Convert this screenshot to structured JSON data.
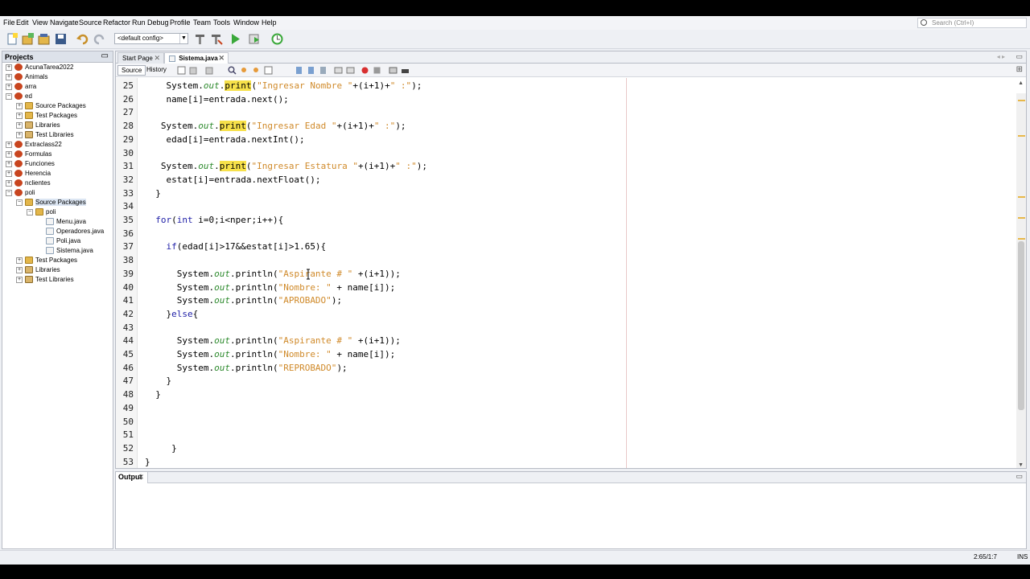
{
  "menubar": {
    "items": [
      "File",
      "Edit",
      "View",
      "Navigate",
      "Source",
      "Refactor",
      "Run",
      "Debug",
      "Profile",
      "Team",
      "Tools",
      "Window",
      "Help"
    ]
  },
  "search": {
    "placeholder": "Search (Ctrl+I)"
  },
  "toolbar": {
    "config_value": "<default config>"
  },
  "projects": {
    "title": "Projects",
    "minimize": "▭",
    "tree": [
      {
        "label": "AcunaTarea2022",
        "exp": "+",
        "icon": "project-icon"
      },
      {
        "label": "Animals",
        "exp": "+",
        "icon": "project-icon"
      },
      {
        "label": "arra",
        "exp": "+",
        "icon": "project-icon"
      },
      {
        "label": "ed",
        "exp": "−",
        "icon": "project-icon"
      },
      {
        "label": "Source Packages",
        "exp": "+",
        "icon": "package-icon"
      },
      {
        "label": "Test Packages",
        "exp": "+",
        "icon": "package-icon"
      },
      {
        "label": "Libraries",
        "exp": "+",
        "icon": "library-icon"
      },
      {
        "label": "Test Libraries",
        "exp": "+",
        "icon": "library-icon"
      },
      {
        "label": "Extraclass22",
        "exp": "+",
        "icon": "project-icon"
      },
      {
        "label": "Formulas",
        "exp": "+",
        "icon": "project-icon"
      },
      {
        "label": "Funciones",
        "exp": "+",
        "icon": "project-icon"
      },
      {
        "label": "Herencia",
        "exp": "+",
        "icon": "project-icon"
      },
      {
        "label": "nclientes",
        "exp": "+",
        "icon": "project-icon"
      },
      {
        "label": "poli",
        "exp": "−",
        "icon": "project-icon"
      },
      {
        "label": "Source Packages",
        "exp": "−",
        "icon": "package-icon"
      },
      {
        "label": "poli",
        "exp": "−",
        "icon": "package-icon"
      },
      {
        "label": "Menu.java",
        "exp": "",
        "icon": "java-file-icon"
      },
      {
        "label": "Operadores.java",
        "exp": "",
        "icon": "java-file-icon"
      },
      {
        "label": "Poli.java",
        "exp": "",
        "icon": "java-file-icon"
      },
      {
        "label": "Sistema.java",
        "exp": "",
        "icon": "java-file-icon"
      },
      {
        "label": "Test Packages",
        "exp": "+",
        "icon": "package-icon"
      },
      {
        "label": "Libraries",
        "exp": "+",
        "icon": "library-icon"
      },
      {
        "label": "Test Libraries",
        "exp": "+",
        "icon": "library-icon"
      }
    ]
  },
  "editor": {
    "tabs": [
      {
        "label": "Start Page",
        "close": "✕"
      },
      {
        "label": "Sistema.java",
        "close": "✕"
      }
    ],
    "source_label": "Source",
    "history_label": "History",
    "line_numbers": [
      "25",
      "26",
      "27",
      "28",
      "29",
      "30",
      "31",
      "32",
      "33",
      "34",
      "35",
      "36",
      "37",
      "38",
      "39",
      "40",
      "41",
      "42",
      "43",
      "44",
      "45",
      "46",
      "47",
      "48",
      "49",
      "50",
      "51",
      "52",
      "53"
    ],
    "code_lines": [
      "    System.out.print(\"Ingresar Nombre \"+(i+1)+\" :\");",
      "    name[i]=entrada.next();",
      "",
      "   System.out.print(\"Ingresar Edad \"+(i+1)+\" :\");",
      "    edad[i]=entrada.nextInt();",
      "",
      "   System.out.print(\"Ingresar Estatura \"+(i+1)+\" :\");",
      "    estat[i]=entrada.nextFloat();",
      "  }",
      "",
      "  for(int i=0;i<nper;i++){",
      "",
      "    if(edad[i]>17&&estat[i]>1.65){",
      "",
      "      System.out.println(\"Aspirante # \" +(i+1));",
      "      System.out.println(\"Nombre: \" + name[i]);",
      "      System.out.println(\"APROBADO\");",
      "    }else{",
      "",
      "      System.out.println(\"Aspirante # \" +(i+1));",
      "      System.out.println(\"Nombre: \" + name[i]);",
      "      System.out.println(\"REPROBADO\");",
      "    }",
      "  }",
      "",
      "",
      "",
      "     }",
      "}"
    ]
  },
  "output": {
    "title": "Output",
    "close": "✕"
  },
  "status": {
    "position": "2:65/1:7",
    "mode": "INS"
  },
  "colors": {
    "keyword": "#2222a8",
    "field": "#2d8a2d",
    "string": "#d08a2a",
    "highlight": "#f7e14a"
  }
}
